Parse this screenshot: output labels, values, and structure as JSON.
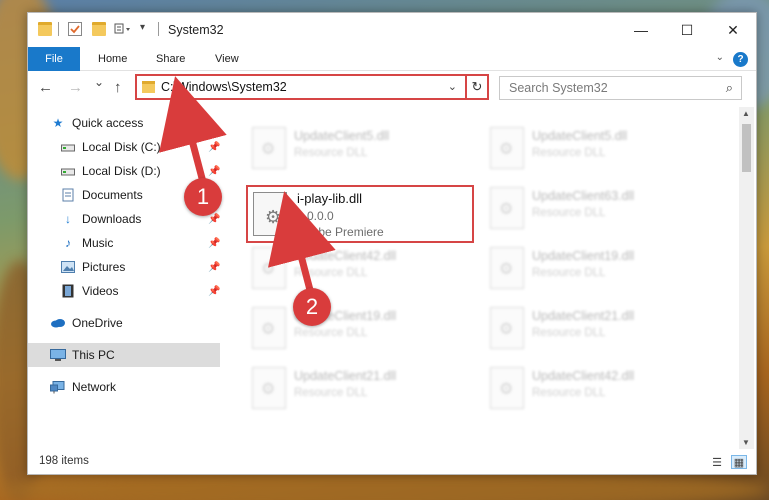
{
  "window": {
    "title": "System32",
    "buttons": {
      "minimize": "—",
      "maximize": "☐",
      "close": "✕"
    }
  },
  "ribbon": {
    "file": "File",
    "home": "Home",
    "share": "Share",
    "view": "View",
    "help": "?"
  },
  "nav": {
    "back": "←",
    "forward": "→",
    "recent": "⌄",
    "up": "↑",
    "address": "C:\\Windows\\System32",
    "address_dropdown": "⌄",
    "refresh": "↻",
    "search_placeholder": "Search System32",
    "search_icon": "⌕"
  },
  "sidebar": {
    "items": [
      {
        "label": "Quick access",
        "icon": "star-icon"
      },
      {
        "label": "Local Disk (C:)",
        "icon": "drive-icon"
      },
      {
        "label": "Local Disk (D:)",
        "icon": "drive-icon"
      },
      {
        "label": "Documents",
        "icon": "documents-icon"
      },
      {
        "label": "Downloads",
        "icon": "downloads-icon"
      },
      {
        "label": "Music",
        "icon": "music-icon"
      },
      {
        "label": "Pictures",
        "icon": "pictures-icon"
      },
      {
        "label": "Videos",
        "icon": "videos-icon"
      },
      {
        "label": "OneDrive",
        "icon": "cloud-icon"
      },
      {
        "label": "This PC",
        "icon": "computer-icon"
      },
      {
        "label": "Network",
        "icon": "network-icon"
      }
    ]
  },
  "files": {
    "target": {
      "name": "i-play-lib.dll",
      "version": "6.0.0.0",
      "description": "Adobe Premiere"
    },
    "blurred": [
      {
        "name": "UpdateClient5.dll",
        "type": "Resource DLL"
      },
      {
        "name": "UpdateClient5.dll",
        "type": "Resource DLL"
      },
      {
        "name": "UpdateClient63.dll",
        "type": "Resource DLL"
      },
      {
        "name": "UpdateClient42.dll",
        "type": "Resource DLL"
      },
      {
        "name": "UpdateClient19.dll",
        "type": "Resource DLL"
      },
      {
        "name": "UpdateClient19.dll",
        "type": "Resource DLL"
      },
      {
        "name": "UpdateClient21.dll",
        "type": "Resource DLL"
      },
      {
        "name": "UpdateClient21.dll",
        "type": "Resource DLL"
      },
      {
        "name": "UpdateClient42.dll",
        "type": "Resource DLL"
      }
    ]
  },
  "status": {
    "count": "198 items"
  },
  "callouts": {
    "one": "1",
    "two": "2"
  },
  "colors": {
    "accent": "#1979ca",
    "highlight": "#d64545"
  }
}
